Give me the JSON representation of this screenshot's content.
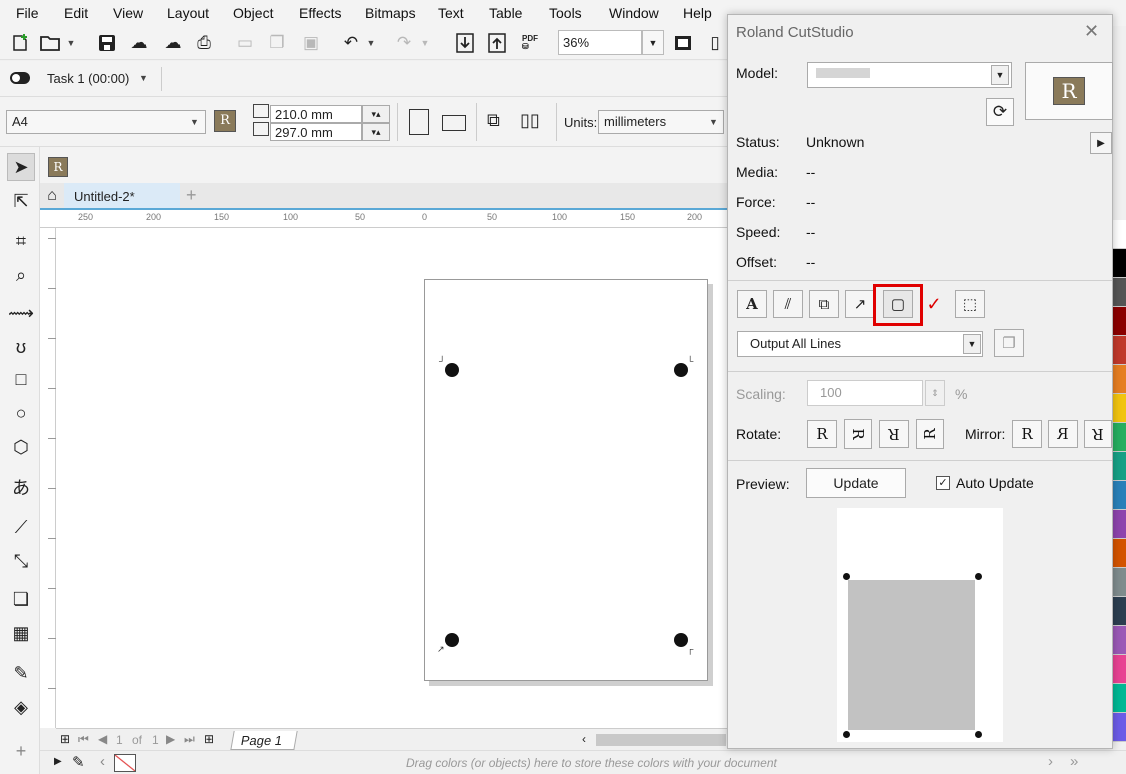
{
  "menu": [
    "File",
    "Edit",
    "View",
    "Layout",
    "Object",
    "Effects",
    "Bitmaps",
    "Text",
    "Table",
    "Tools",
    "Window",
    "Help"
  ],
  "toolbar": {
    "zoom": "36%"
  },
  "task": {
    "label": "Task 1 (00:00)"
  },
  "props": {
    "page_size": "A4",
    "width": "210.0 mm",
    "height": "297.0 mm",
    "units_label": "Units:",
    "units": "millimeters"
  },
  "doc": {
    "tab": "Untitled-2*"
  },
  "ruler": {
    "h": [
      "250",
      "200",
      "150",
      "100",
      "50",
      "0",
      "50",
      "100",
      "150",
      "200"
    ]
  },
  "pagenav": {
    "page_num": "1",
    "of": "of",
    "total": "1",
    "page_tab": "Page 1"
  },
  "status": {
    "hint": "Drag colors (or objects) here to store these colors with your document"
  },
  "dock": {
    "title": "Roland CutStudio",
    "model_label": "Model:",
    "model_value": "",
    "status_label": "Status:",
    "status_value": "Unknown",
    "media_label": "Media:",
    "media_value": "--",
    "force_label": "Force:",
    "force_value": "--",
    "speed_label": "Speed:",
    "speed_value": "--",
    "offset_label": "Offset:",
    "offset_value": "--",
    "output": "Output All Lines",
    "scaling_label": "Scaling:",
    "scaling_value": "100",
    "scaling_unit": "%",
    "rotate_label": "Rotate:",
    "mirror_label": "Mirror:",
    "rotate": [
      "R",
      "R",
      "R",
      "R"
    ],
    "mirror": [
      "R",
      "R",
      "R"
    ],
    "preview_label": "Preview:",
    "update": "Update",
    "auto_update": "Auto Update",
    "highlight_color": "#e00000"
  },
  "palette_colors": [
    "#ffffff",
    "#000000",
    "#555555",
    "#8b0000",
    "#c0392b",
    "#e67e22",
    "#f1c40f",
    "#27ae60",
    "#16a085",
    "#2980b9",
    "#8e44ad",
    "#d35400",
    "#7f8c8d",
    "#2c3e50",
    "#9b59b6",
    "#e84393",
    "#00b894",
    "#6c5ce7"
  ]
}
